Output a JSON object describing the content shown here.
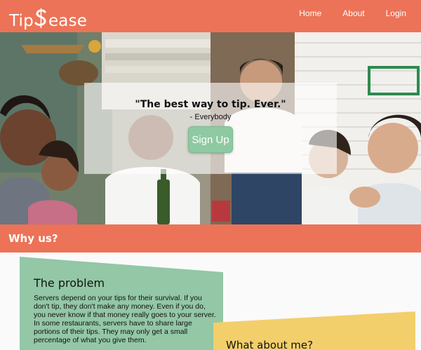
{
  "navbar": {
    "logo_prefix": "Tip",
    "logo_suffix": "ease",
    "links": [
      "Home",
      "About",
      "Login"
    ]
  },
  "hero": {
    "quote": "\"The best way to tip. Ever.\"",
    "author": "- Everybody",
    "cta_label": "Sign Up"
  },
  "why": {
    "title": "Why us?"
  },
  "problem": {
    "title": "The problem",
    "paragraphs": [
      "Servers depend on your tips for their survival. If you don't tip, they don't make any money. Even if you do, you never know if that money really goes to your server.",
      "In some restaurants, servers have to share large portions of their tips. They may only get a small percentage of what you give them."
    ]
  },
  "what_about_me": {
    "title": "What about me?"
  },
  "colors": {
    "brand": "#ec7357",
    "button_green": "#8fc9a2",
    "problem_card": "#93c7a6",
    "whatabout_card": "#f2cf6b"
  }
}
